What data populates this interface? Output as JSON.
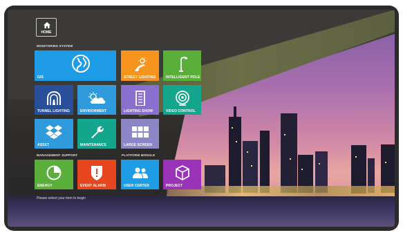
{
  "header": {
    "home_label": "HOME"
  },
  "sections": {
    "monitoring": "MONITORING SYSTEM",
    "management": "MANAGEMENT SUPPORT",
    "platform": "PLATFORM MODULE"
  },
  "tiles": {
    "gis": "GIS",
    "street_lighting": "STREET LIGHTING",
    "intelligent_pole": "INTELLIGENT POLE",
    "tunnel_lighting": "TUNNEL LIGHTING",
    "environment": "ENVIRONMENT",
    "lighting_show": "LIGHTING SHOW",
    "video_control": "VIDEO CONTROL",
    "asset": "ASSET",
    "maintenance": "MAINTENANCE",
    "large_screen": "LARGE SCREEN",
    "energy": "ENERGY",
    "event_alarm": "EVENT ALARM",
    "user_center": "USER CENTER",
    "project": "PROJECT"
  },
  "footer": {
    "hint": "Please select your item to begin"
  },
  "colors": {
    "blue": "#1e9de6",
    "orange": "#f7941d",
    "green": "#5aaf3a",
    "navy": "#2a4f9a",
    "sky": "#2f9bdc",
    "violet": "#8a6fcf",
    "teal": "#14a58f",
    "red": "#e8461e",
    "purple": "#9a33b8",
    "gray_violet": "#8c86c6"
  }
}
